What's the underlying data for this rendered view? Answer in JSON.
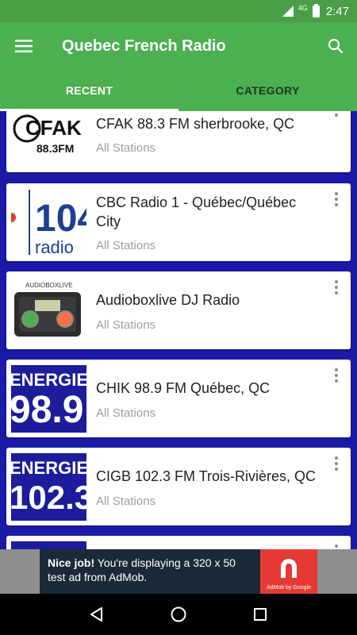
{
  "status_bar": {
    "network": "4G",
    "time": "2:47"
  },
  "app_bar": {
    "title": "Quebec French Radio",
    "menu_icon": "hamburger-menu-icon",
    "search_icon": "search-icon"
  },
  "tabs": [
    {
      "label": "RECENT",
      "active": true
    },
    {
      "label": "CATEGORY",
      "active": false
    }
  ],
  "stations": [
    {
      "name": "CFAK 88.3 FM sherbrooke, QC",
      "category": "All Stations",
      "logo": {
        "line1": "CFAK",
        "line2": "88.3FM"
      }
    },
    {
      "name": "CBC Radio 1 - Québec/Québec City",
      "category": "All Stations",
      "logo": {
        "line1": "104",
        "line2": "radio"
      }
    },
    {
      "name": "Audioboxlive DJ Radio",
      "category": "All Stations",
      "logo": {
        "line1": "AUDIOBOXLIVE",
        "line2": ""
      }
    },
    {
      "name": "CHIK 98.9 FM Québec, QC",
      "category": "All Stations",
      "logo": {
        "line1": "ENERGIE",
        "line2": "98.9"
      }
    },
    {
      "name": "CIGB 102.3 FM Trois-Rivières, QC",
      "category": "All Stations",
      "logo": {
        "line1": "ENERGIE",
        "line2": "102.3"
      }
    }
  ],
  "ad": {
    "headline": "Nice job!",
    "body": "You're displaying a 320 x 50 test ad from AdMob.",
    "badge": "AdMob by Google"
  },
  "colors": {
    "primary": "#4caf50",
    "status": "#4a9e45",
    "list_bg": "#1a1aa6",
    "energie_blue": "#1c1c9c"
  }
}
